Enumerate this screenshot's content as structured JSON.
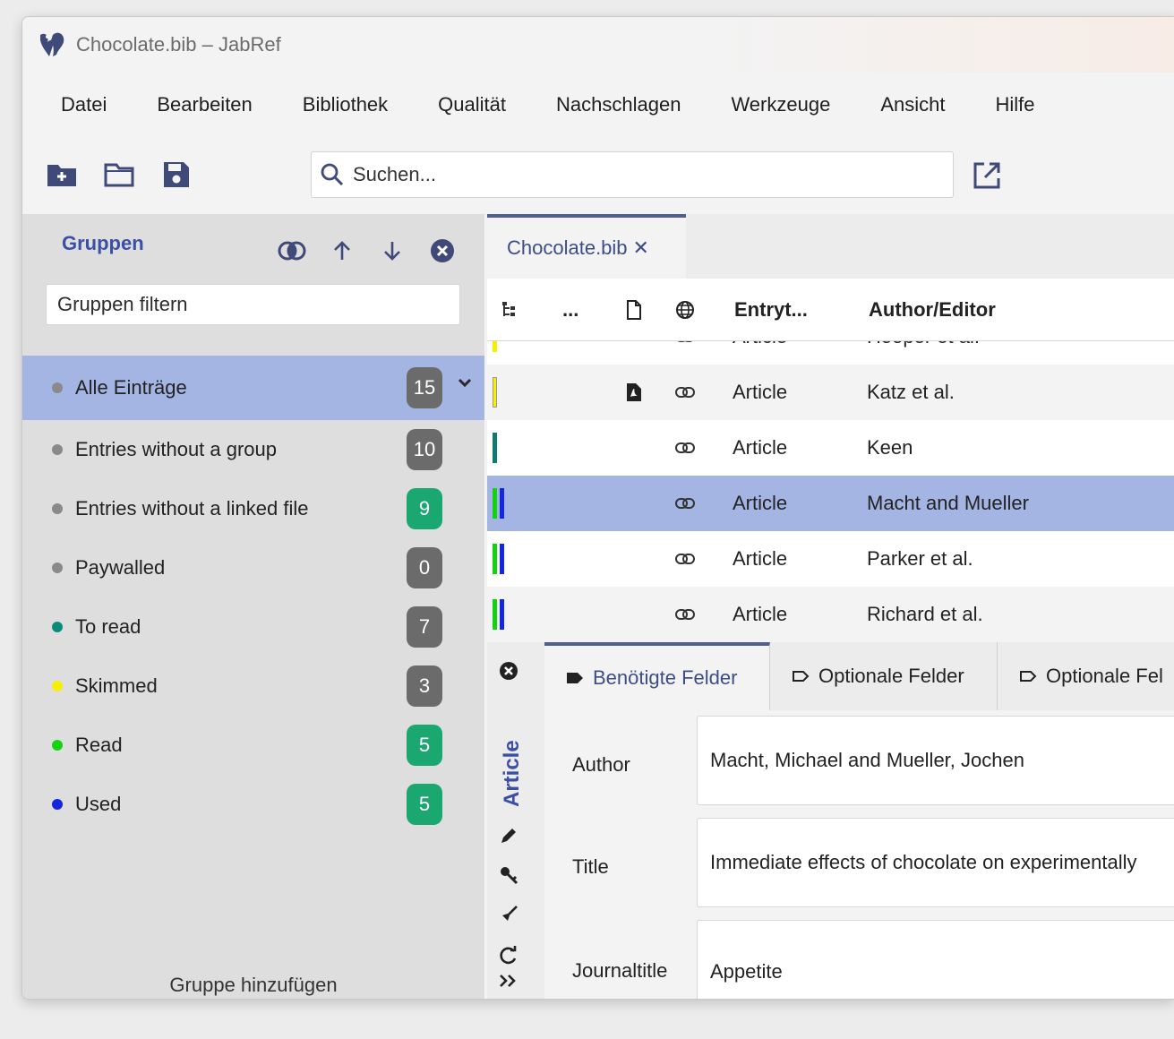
{
  "window": {
    "title": "Chocolate.bib – JabRef"
  },
  "menu": [
    "Datei",
    "Bearbeiten",
    "Bibliothek",
    "Qualität",
    "Nachschlagen",
    "Werkzeuge",
    "Ansicht",
    "Hilfe"
  ],
  "search": {
    "placeholder": "Suchen..."
  },
  "groups": {
    "title": "Gruppen",
    "filter_placeholder": "Gruppen filtern",
    "add_label": "Gruppe hinzufügen",
    "items": [
      {
        "label": "Alle Einträge",
        "count": "15",
        "dot": "#8a8a8a",
        "badge": "#6b6b6b"
      },
      {
        "label": "Entries without a group",
        "count": "10",
        "dot": "#8a8a8a",
        "badge": "#6b6b6b"
      },
      {
        "label": "Entries without a linked file",
        "count": "9",
        "dot": "#8a8a8a",
        "badge": "#1aa870"
      },
      {
        "label": "Paywalled",
        "count": "0",
        "dot": "#8a8a8a",
        "badge": "#6b6b6b"
      },
      {
        "label": "To read",
        "count": "7",
        "dot": "#0e8a7d",
        "badge": "#6b6b6b"
      },
      {
        "label": "Skimmed",
        "count": "3",
        "dot": "#f6f000",
        "badge": "#6b6b6b"
      },
      {
        "label": "Read",
        "count": "5",
        "dot": "#12d312",
        "badge": "#1aa870"
      },
      {
        "label": "Used",
        "count": "5",
        "dot": "#1326e0",
        "badge": "#1aa870"
      }
    ]
  },
  "library_tab": {
    "label": "Chocolate.bib",
    "close": "✕"
  },
  "table": {
    "headers": {
      "more": "...",
      "entrytype": "Entryt...",
      "author": "Author/Editor"
    },
    "rows": [
      {
        "type": "Article",
        "author": "Hooper et al."
      },
      {
        "type": "Article",
        "author": "Katz et al."
      },
      {
        "type": "Article",
        "author": "Keen"
      },
      {
        "type": "Article",
        "author": "Macht and Mueller"
      },
      {
        "type": "Article",
        "author": "Parker et al."
      },
      {
        "type": "Article",
        "author": "Richard et al."
      }
    ]
  },
  "editor": {
    "entry_type": "Article",
    "tabs": [
      "Benötigte Felder",
      "Optionale Felder",
      "Optionale Fel"
    ],
    "fields": [
      {
        "label": "Author",
        "value": "Macht, Michael and Mueller, Jochen"
      },
      {
        "label": "Title",
        "value": "Immediate effects of chocolate on experimentally"
      },
      {
        "label": "Journaltitle",
        "value": "Appetite"
      }
    ]
  }
}
